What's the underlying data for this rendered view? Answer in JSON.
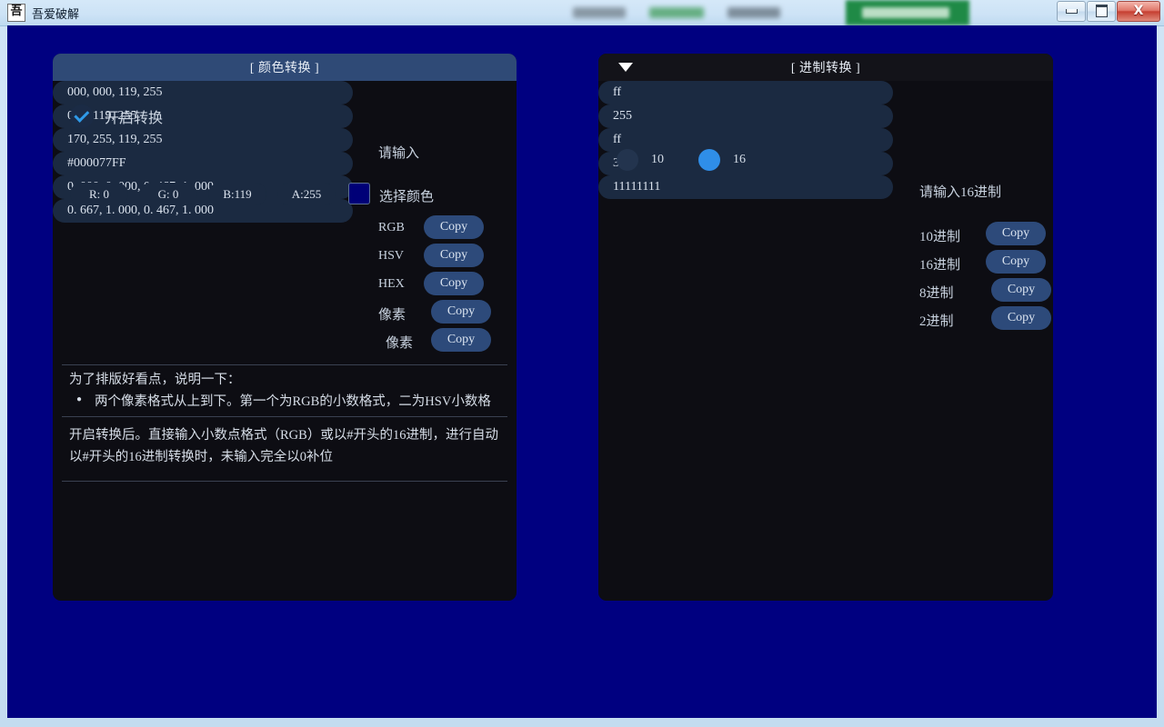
{
  "window": {
    "app_name": "吾爱破解",
    "app_icon_glyph": "吾",
    "icon_name": "app-icon",
    "controls": {
      "minimize_name": "minimize-button",
      "maximize_name": "maximize-button",
      "close_glyph": "X"
    }
  },
  "color_panel": {
    "title": "[ 颜色转换 ]",
    "enable_checkbox_label": "开启转换",
    "enable_checked": true,
    "input": {
      "value": "000, 000, 119, 255",
      "label": "请输入"
    },
    "channels": [
      {
        "label": "R:  0"
      },
      {
        "label": "G:  0"
      },
      {
        "label": "B:119"
      },
      {
        "label": "A:255"
      }
    ],
    "swatch_color": "#000077",
    "swatch_label": "选择颜色",
    "rows": [
      {
        "value": "0, 0, 119, 255",
        "label": "RGB",
        "copy": "Copy"
      },
      {
        "value": "170, 255, 119, 255",
        "label": "HSV",
        "copy": "Copy"
      },
      {
        "value": "#000077FF",
        "label": "HEX",
        "copy": "Copy"
      },
      {
        "value": "0. 000, 0. 000, 0. 467, 1. 000",
        "label": "像素",
        "copy": "Copy"
      },
      {
        "value": "0. 667, 1. 000, 0. 467, 1. 000",
        "label": "像素",
        "copy": "Copy"
      }
    ],
    "notes": {
      "heading": "为了排版好看点，说明一下：",
      "bullet": "两个像素格式从上到下。第一个为RGB的小数格式，二为HSV小数格",
      "line1": "开启转换后。直接输入小数点格式（RGB）或以#开头的16进制，进行自动",
      "line2": "以#开头的16进制转换时，未输入完全以0补位"
    }
  },
  "radix_panel": {
    "title": "[ 进制转换 ]",
    "collapse_icon": "triangle-down-icon",
    "radios": [
      {
        "label": "10",
        "selected": false
      },
      {
        "label": "16",
        "selected": true
      }
    ],
    "input": {
      "value": "ff",
      "label": "请输入16进制"
    },
    "rows": [
      {
        "value": "255",
        "label": "10进制",
        "copy": "Copy"
      },
      {
        "value": "ff",
        "label": "16进制",
        "copy": "Copy"
      },
      {
        "value": "377",
        "label": "8进制",
        "copy": "Copy"
      },
      {
        "value": "11111111",
        "label": "2进制",
        "copy": "Copy"
      }
    ]
  }
}
